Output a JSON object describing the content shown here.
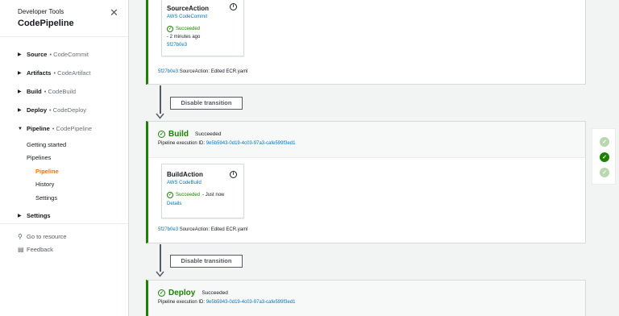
{
  "sidebar": {
    "service": "Developer Tools",
    "title": "CodePipeline",
    "groups": {
      "source": {
        "label": "Source",
        "sub": "• CodeCommit"
      },
      "artifacts": {
        "label": "Artifacts",
        "sub": "• CodeArtifact"
      },
      "build": {
        "label": "Build",
        "sub": "• CodeBuild"
      },
      "deploy": {
        "label": "Deploy",
        "sub": "• CodeDeploy"
      },
      "pipeline": {
        "label": "Pipeline",
        "sub": "• CodePipeline"
      },
      "settings": {
        "label": "Settings"
      }
    },
    "items": {
      "getting_started": "Getting started",
      "pipelines": "Pipelines",
      "pipeline": "Pipeline",
      "history": "History",
      "settings": "Settings"
    },
    "go_to_resource": "Go to resource",
    "feedback": "Feedback"
  },
  "source_stage": {
    "action": {
      "name": "SourceAction",
      "provider": "AWS CodeCommit",
      "status": "Succeeded",
      "time": "- 2 minutes ago",
      "commit": "5f27b0e3"
    },
    "commit_id": "5f27b0e3",
    "commit_msg": "SourceAction: Edited ECR.yaml"
  },
  "transition_label": "Disable transition",
  "build_stage": {
    "name": "Build",
    "status": "Succeeded",
    "exec_label": "Pipeline execution ID:",
    "exec_id": "9e5b5943-0d19-4c03-97a3-cafe599f3ed1",
    "action": {
      "name": "BuildAction",
      "provider": "AWS CodeBuild",
      "status": "Succeeded",
      "time": "- Just now",
      "details": "Details"
    },
    "commit_id": "5f27b0e3",
    "commit_msg": "SourceAction: Edited ECR.yaml"
  },
  "deploy_stage": {
    "name": "Deploy",
    "status": "Succeeded",
    "exec_label": "Pipeline execution ID:",
    "exec_id": "9e5b5943-0d19-4c03-97a3-cafe599f3ed1"
  },
  "icons": {
    "success": "check-circle-icon",
    "info": "info-icon",
    "close": "close-icon",
    "search": "search-icon",
    "feedback": "feedback-icon"
  },
  "colors": {
    "success": "#1d8102",
    "link": "#0073bb",
    "active": "#ec7211"
  }
}
